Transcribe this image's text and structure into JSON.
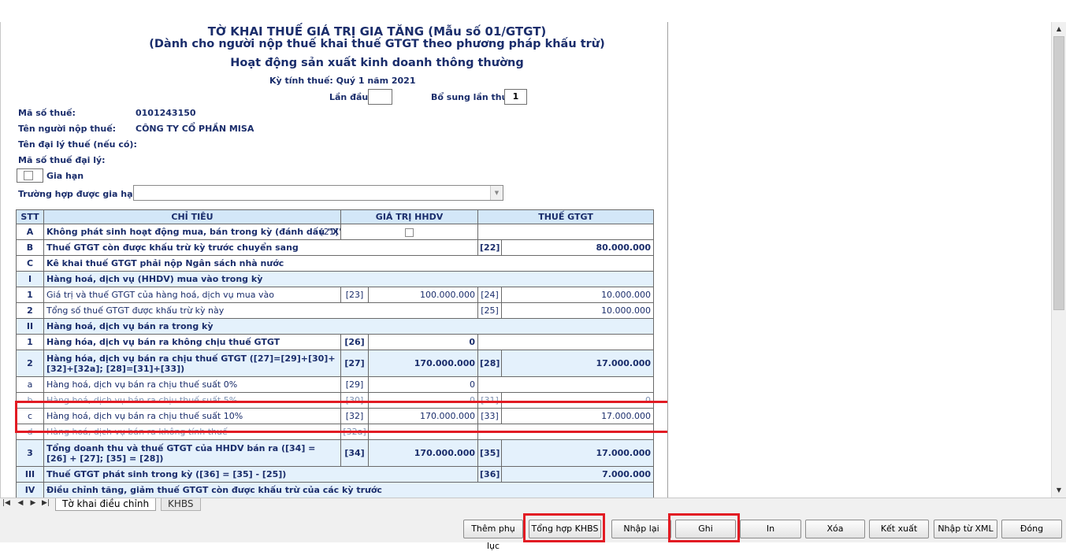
{
  "header": {
    "title_line1": "TỜ KHAI THUẾ GIÁ TRỊ GIA TĂNG (Mẫu số 01/GTGT)",
    "title_line2": "(Dành cho người nộp thuế khai thuế GTGT theo phương pháp khấu trừ)",
    "title_line3": "Hoạt động sản xuất kinh doanh thông thường",
    "period_label": "Kỳ tính thuế: Quý 1 năm 2021",
    "first_time_label": "Lần đầu:",
    "first_time_value": "",
    "supplement_label": "Bổ sung lần thứ:",
    "supplement_value": "1"
  },
  "taxpayer": {
    "tax_code_label": "Mã số thuế:",
    "tax_code_value": "0101243150",
    "name_label": "Tên người nộp thuế:",
    "name_value": "CÔNG TY CỔ PHẦN MISA",
    "agent_label": "Tên đại lý thuế (nếu có):",
    "agent_tax_code_label": "Mã số thuế đại lý:",
    "extension_label": "Gia hạn",
    "extension_case_label": "Trường hợp được gia hạn:",
    "extension_case_value": ""
  },
  "table": {
    "headers": [
      "STT",
      "CHỈ TIÊU",
      "GIÁ TRỊ HHDV",
      "THUẾ GTGT"
    ],
    "rows": [
      {
        "stt": "A",
        "label": "Không phát sinh hoạt động mua, bán trong kỳ (đánh dấu \"X\")",
        "code_a": "[21]"
      },
      {
        "stt": "B",
        "label": "Thuế GTGT còn được khấu trừ kỳ trước chuyển sang",
        "code_b": "[22]",
        "val_b": "80.000.000"
      },
      {
        "stt": "C",
        "label": "Kê khai thuế GTGT phải nộp Ngân sách nhà nước"
      },
      {
        "stt": "I",
        "label": "Hàng hoá, dịch vụ (HHDV) mua vào trong kỳ"
      },
      {
        "stt": "1",
        "label": "Giá trị và thuế GTGT của hàng hoá, dịch vụ mua vào",
        "code_a": "[23]",
        "val_a": "100.000.000",
        "code_b": "[24]",
        "val_b": "10.000.000"
      },
      {
        "stt": "2",
        "label": "Tổng số thuế GTGT được khấu trừ kỳ này",
        "code_b": "[25]",
        "val_b": "10.000.000"
      },
      {
        "stt": "II",
        "label": "Hàng hoá, dịch vụ bán ra trong kỳ"
      },
      {
        "stt": "1",
        "label": "Hàng hóa, dịch vụ bán ra không chịu thuế GTGT",
        "code_a": "[26]",
        "val_a": "0"
      },
      {
        "stt": "2",
        "label": "Hàng hóa, dịch vụ bán ra chịu thuế GTGT ([27]=[29]+[30]+[32]+[32a]; [28]=[31]+[33])",
        "code_a": "[27]",
        "val_a": "170.000.000",
        "code_b": "[28]",
        "val_b": "17.000.000"
      },
      {
        "stt": "a",
        "label": "Hàng hoá, dịch vụ bán ra chịu thuế suất 0%",
        "code_a": "[29]",
        "val_a": "0"
      },
      {
        "stt": "b",
        "label": "Hàng hoá, dịch vụ bán ra chịu thuế suất 5%",
        "code_a": "[30]",
        "val_a": "0",
        "code_b": "[31]",
        "val_b": "0"
      },
      {
        "stt": "c",
        "label": "Hàng hoá, dịch vụ bán ra chịu thuế suất 10%",
        "code_a": "[32]",
        "val_a": "170.000.000",
        "code_b": "[33]",
        "val_b": "17.000.000"
      },
      {
        "stt": "d",
        "label": "Hàng hoá, dịch vụ bán ra không tính thuế",
        "code_a": "[32a]"
      },
      {
        "stt": "3",
        "label": "Tổng doanh thu và thuế GTGT của HHDV bán ra ([34] = [26] + [27]; [35] = [28])",
        "code_a": "[34]",
        "val_a": "170.000.000",
        "code_b": "[35]",
        "val_b": "17.000.000"
      },
      {
        "stt": "III",
        "label": "Thuế GTGT phát sinh trong kỳ ([36] = [35] - [25])",
        "code_b": "[36]",
        "val_b": "7.000.000"
      },
      {
        "stt": "IV",
        "label": "Điều chỉnh tăng, giảm thuế GTGT còn được khấu trừ của các kỳ trước"
      }
    ]
  },
  "tabs": {
    "tab1": "Tờ khai điều chỉnh",
    "tab2": "KHBS"
  },
  "buttons": {
    "add_appendix": "Thêm phụ lục",
    "summary_khbs": "Tổng hợp KHBS",
    "reenter": "Nhập lại",
    "save": "Ghi",
    "print": "In",
    "delete": "Xóa",
    "export": "Kết xuất",
    "import_xml": "Nhập từ XML",
    "close": "Đóng"
  },
  "colors": {
    "highlight_red": "#e21b23",
    "header_blue": "#d3e7f8",
    "section_blue": "#e4f1fc",
    "text_navy": "#1a2d6b"
  }
}
